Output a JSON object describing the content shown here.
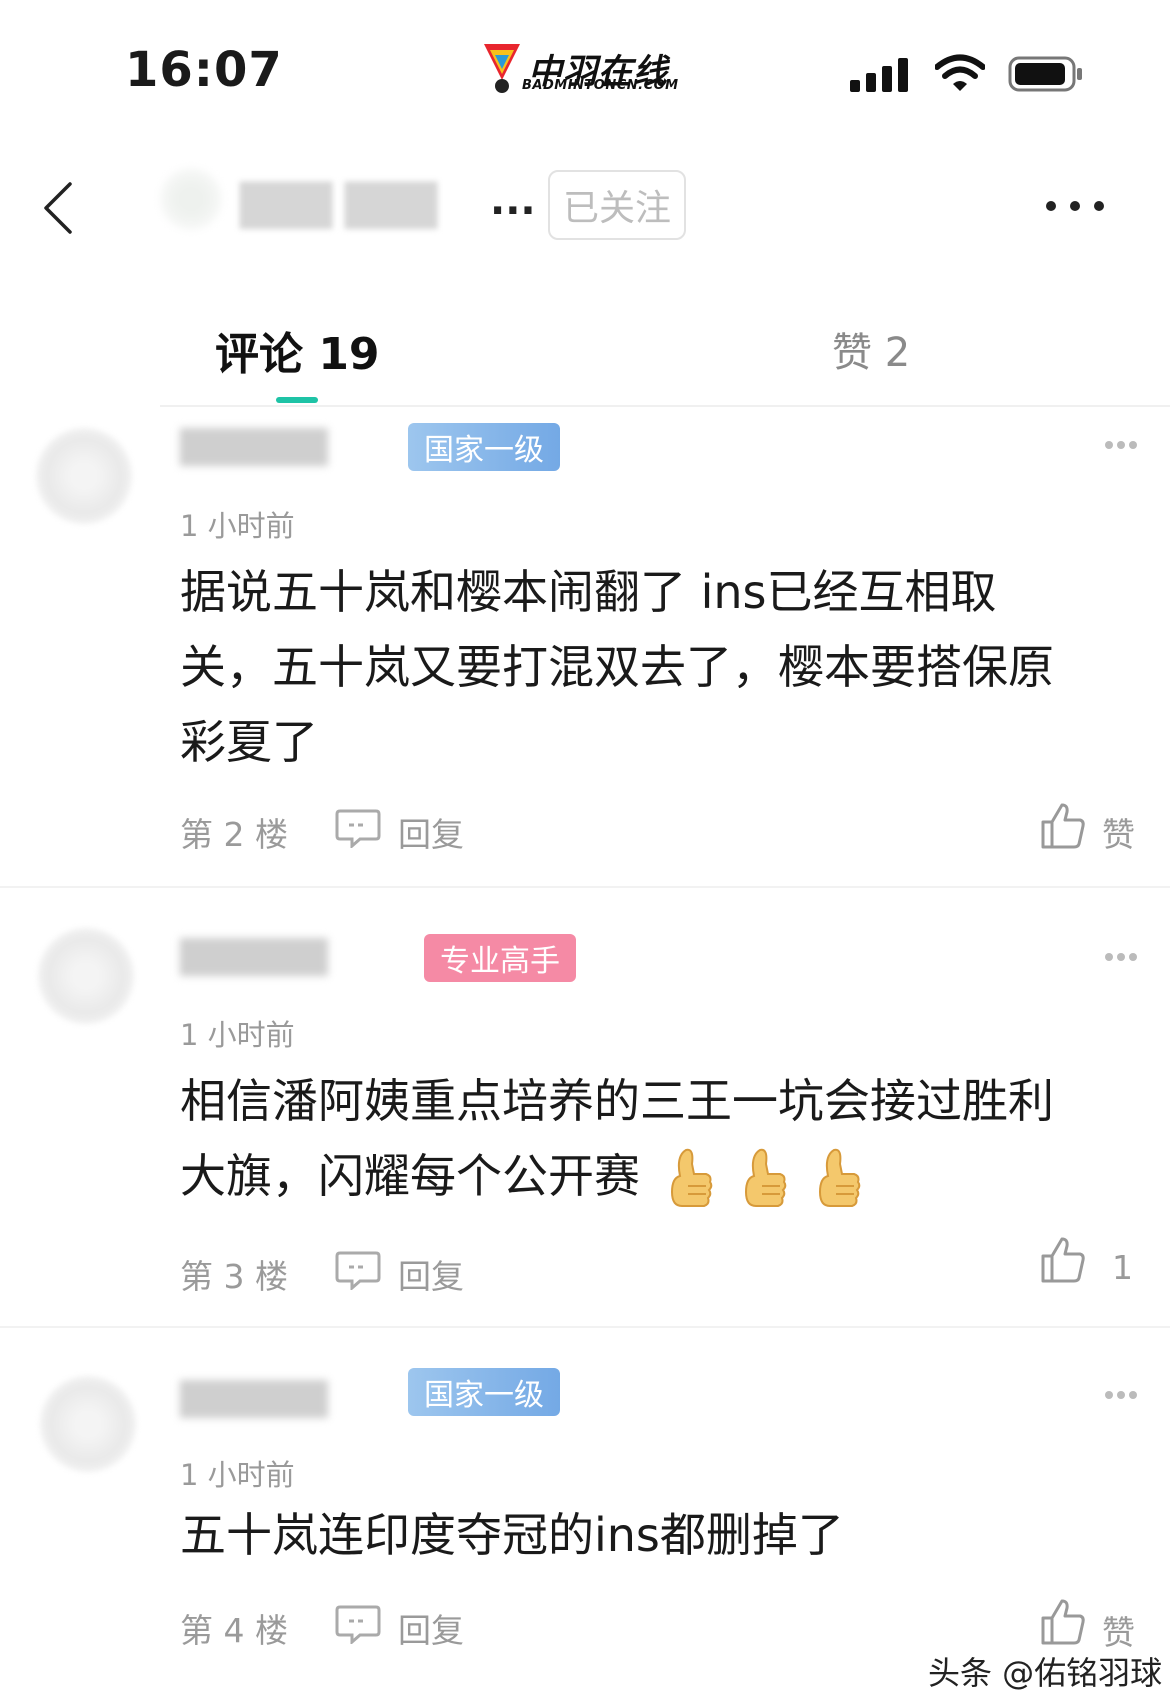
{
  "status_bar": {
    "time": "16:07"
  },
  "brand": {
    "name_cn": "中羽在线",
    "name_en": "BADMINTONCN.COM"
  },
  "header": {
    "author_name": "...",
    "follow_label": "已关注"
  },
  "tabs": {
    "comments_label": "评论 19",
    "likes_label": "赞 2"
  },
  "comments": [
    {
      "badge": "国家一级",
      "time_ago": "1 小时前",
      "text_lines": [
        "据说五十岚和樱本闹翻了 ins已经互相取",
        "关，五十岚又要打混双去了，樱本要搭保原",
        "彩夏了"
      ],
      "floor": "第 2 楼",
      "reply_label": "回复",
      "like_label": "赞"
    },
    {
      "badge": "专业高手",
      "time_ago": "1 小时前",
      "text_lines": [
        "相信潘阿姨重点培养的三王一坑会接过胜利",
        "大旗，闪耀每个公开赛"
      ],
      "floor": "第 3 楼",
      "reply_label": "回复",
      "like_label": "1"
    },
    {
      "badge": "国家一级",
      "time_ago": "1 小时前",
      "text_lines": [
        "五十岚连印度夺冠的ins都删掉了"
      ],
      "floor": "第 4 楼",
      "reply_label": "回复",
      "like_label": "赞"
    }
  ],
  "watermark": "头条 @佑铭羽球",
  "colors": {
    "accent": "#1ec3a6",
    "badge_blue": "#74a9e5",
    "badge_pink": "#f58aa5"
  }
}
